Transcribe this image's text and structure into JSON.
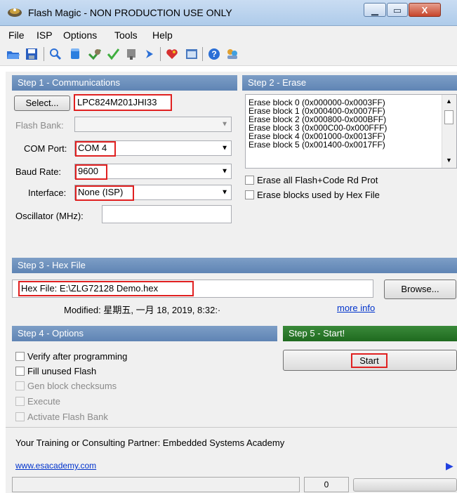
{
  "window": {
    "title": "Flash Magic - NON PRODUCTION USE ONLY",
    "minimize_glyph": "▁",
    "maximize_glyph": "▭",
    "close_glyph": "X"
  },
  "menu": {
    "items": [
      "File",
      "ISP",
      "Options",
      "Tools",
      "Help"
    ]
  },
  "toolbar": {
    "icons": [
      "open-icon",
      "save-icon",
      "search-icon",
      "erase-icon",
      "verify-icon",
      "check-icon",
      "flag-icon",
      "go-icon",
      "heart-icon",
      "terminal-icon",
      "help-icon",
      "users-icon"
    ]
  },
  "step1": {
    "header": "Step 1 - Communications",
    "select_button": "Select...",
    "device": "LPC824M201JHI33",
    "flash_bank_label": "Flash Bank:",
    "flash_bank_value": "",
    "com_port_label": "COM Port:",
    "com_port_value": "COM 4",
    "baud_rate_label": "Baud Rate:",
    "baud_rate_value": "9600",
    "interface_label": "Interface:",
    "interface_value": "None (ISP)",
    "oscillator_label": "Oscillator (MHz):",
    "oscillator_value": ""
  },
  "step2": {
    "header": "Step 2 - Erase",
    "blocks": [
      "Erase block 0 (0x000000-0x0003FF)",
      "Erase block 1 (0x000400-0x0007FF)",
      "Erase block 2 (0x000800-0x000BFF)",
      "Erase block 3 (0x000C00-0x000FFF)",
      "Erase block 4 (0x001000-0x0013FF)",
      "Erase block 5 (0x001400-0x0017FF)"
    ],
    "erase_all_label": "Erase all Flash+Code Rd Prot",
    "erase_used_label": "Erase blocks used by Hex File"
  },
  "step3": {
    "header": "Step 3 - Hex File",
    "hex_file_label": "Hex File:",
    "hex_file_value": "E:\\ZLG72128 Demo.hex",
    "browse_button": "Browse...",
    "modified_text": "Modified: 星期五, 一月 18, 2019, 8:32:·",
    "more_info_link": "more info"
  },
  "step4": {
    "header": "Step 4 - Options",
    "verify_label": "Verify after programming",
    "fill_label": "Fill unused Flash",
    "gen_label": "Gen block checksums",
    "execute_label": "Execute",
    "activate_label": "Activate Flash Bank"
  },
  "step5": {
    "header": "Step 5 - Start!",
    "start_button": "Start"
  },
  "footer": {
    "partner_text": "Your Training or Consulting Partner: Embedded Systems Academy",
    "link_text": "www.esacademy.com",
    "status_count": "0"
  },
  "colors": {
    "section_header": "#6b8fbe",
    "step5_header": "#2a7a2a",
    "highlight_box": "#e02020",
    "link": "#0033cc"
  }
}
